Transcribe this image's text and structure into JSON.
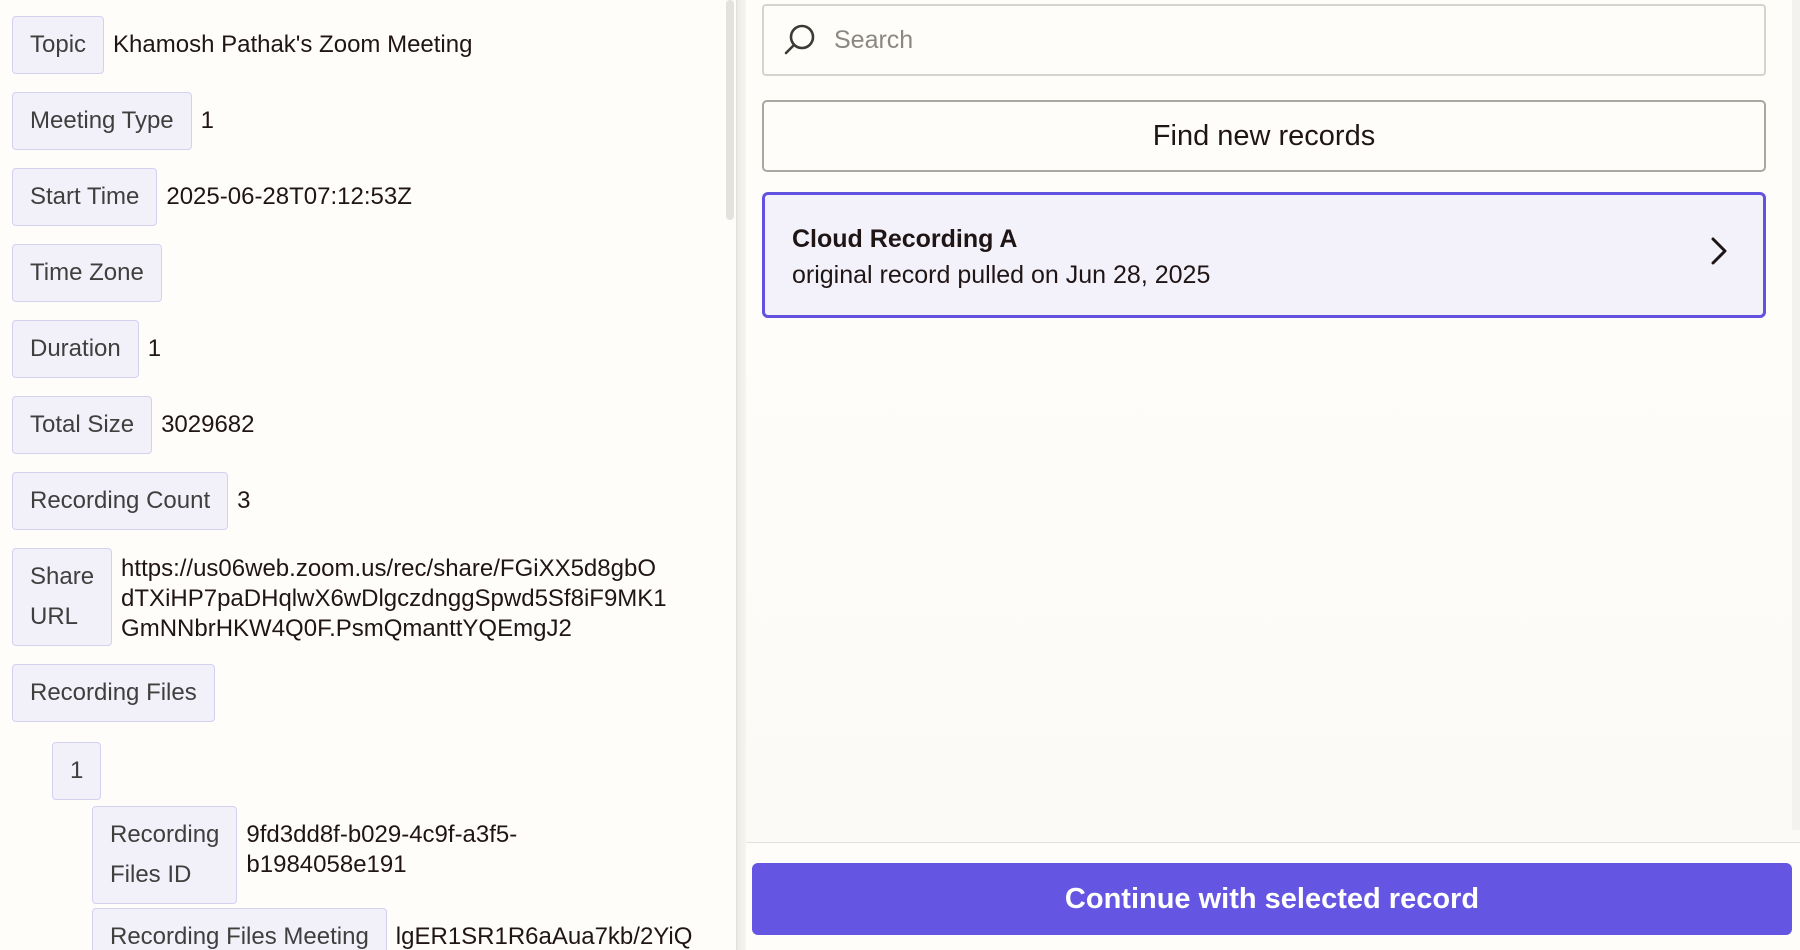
{
  "left": {
    "fields": [
      {
        "key": "Topic",
        "value": "Khamosh Pathak's Zoom Meeting"
      },
      {
        "key": "Meeting Type",
        "value": "1"
      },
      {
        "key": "Start Time",
        "value": "2025-06-28T07:12:53Z"
      },
      {
        "key": "Time Zone",
        "value": ""
      },
      {
        "key": "Duration",
        "value": "1"
      },
      {
        "key": "Total Size",
        "value": "3029682"
      },
      {
        "key": "Recording Count",
        "value": "3"
      },
      {
        "key_lines": [
          "Share",
          "URL"
        ],
        "value_lines": [
          "https://us06web.zoom.us/rec/share/FGiXX5d8gbO",
          "dTXiHP7paDHqlwX6wDlgczdnggSpwd5Sf8iF9MK1",
          "GmNNbrHKW4Q0F.PsmQmanttYQEmgJ2"
        ]
      },
      {
        "key": "Recording Files",
        "value": ""
      },
      {
        "key": "1",
        "value": ""
      },
      {
        "key_lines": [
          "Recording",
          "Files ID"
        ],
        "value_lines": [
          "9fd3dd8f-b029-4c9f-a3f5-",
          "b1984058e191"
        ]
      },
      {
        "key": "Recording Files Meeting",
        "value": "lgER1SR1R6aAua7kb/2YiQ"
      }
    ]
  },
  "search": {
    "placeholder": "Search",
    "icon": "search-icon"
  },
  "find_button": {
    "label": "Find new records"
  },
  "record": {
    "title": "Cloud Recording A",
    "subtitle": "original record pulled on Jun 28, 2025",
    "icon": "chevron-right-icon"
  },
  "continue_button": {
    "label": "Continue with selected record"
  },
  "colors": {
    "accent": "#6455e3",
    "selected_border": "#6152e0",
    "key_bg": "#f2f1fa"
  }
}
